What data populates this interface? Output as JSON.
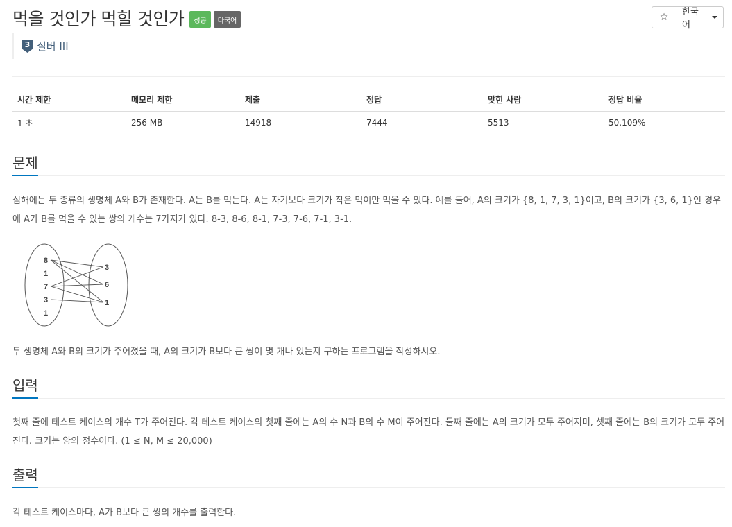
{
  "problem": {
    "title": "먹을 것인가 먹힐 것인가",
    "labels": {
      "success": "성공",
      "multilang": "다국어"
    },
    "tier": {
      "number": "3",
      "name": "실버 III"
    }
  },
  "toolbar": {
    "star": "☆",
    "language": "한국어"
  },
  "info_table": {
    "headers": [
      "시간 제한",
      "메모리 제한",
      "제출",
      "정답",
      "맞힌 사람",
      "정답 비율"
    ],
    "values": [
      "1 초",
      "256 MB",
      "14918",
      "7444",
      "5513",
      "50.109%"
    ]
  },
  "sections": {
    "problem": {
      "heading": "문제",
      "paragraph1": "심해에는 두 종류의 생명체 A와 B가 존재한다. A는 B를 먹는다. A는 자기보다 크기가 작은 먹이만 먹을 수 있다. 예를 들어, A의 크기가 {8, 1, 7, 3, 1}이고, B의 크기가 {3, 6, 1}인 경우에 A가 B를 먹을 수 있는 쌍의 개수는 7가지가 있다. 8-3, 8-6, 8-1, 7-3, 7-6, 7-1, 3-1.",
      "paragraph2": "두 생명체 A와 B의 크기가 주어졌을 때, A의 크기가 B보다 큰 쌍이 몇 개나 있는지 구하는 프로그램을 작성하시오."
    },
    "input": {
      "heading": "입력",
      "text": "첫째 줄에 테스트 케이스의 개수 T가 주어진다. 각 테스트 케이스의 첫째 줄에는 A의 수 N과 B의 수 M이 주어진다. 둘째 줄에는 A의 크기가 모두 주어지며, 셋째 줄에는 B의 크기가 모두 주어진다. 크기는 양의 정수이다. (1 ≤ N, M ≤ 20,000)"
    },
    "output": {
      "heading": "출력",
      "text": "각 테스트 케이스마다, A가 B보다 큰 쌍의 개수를 출력한다."
    }
  },
  "figure": {
    "set_a": [
      "8",
      "1",
      "7",
      "3",
      "1"
    ],
    "set_b": [
      "3",
      "6",
      "1"
    ]
  }
}
